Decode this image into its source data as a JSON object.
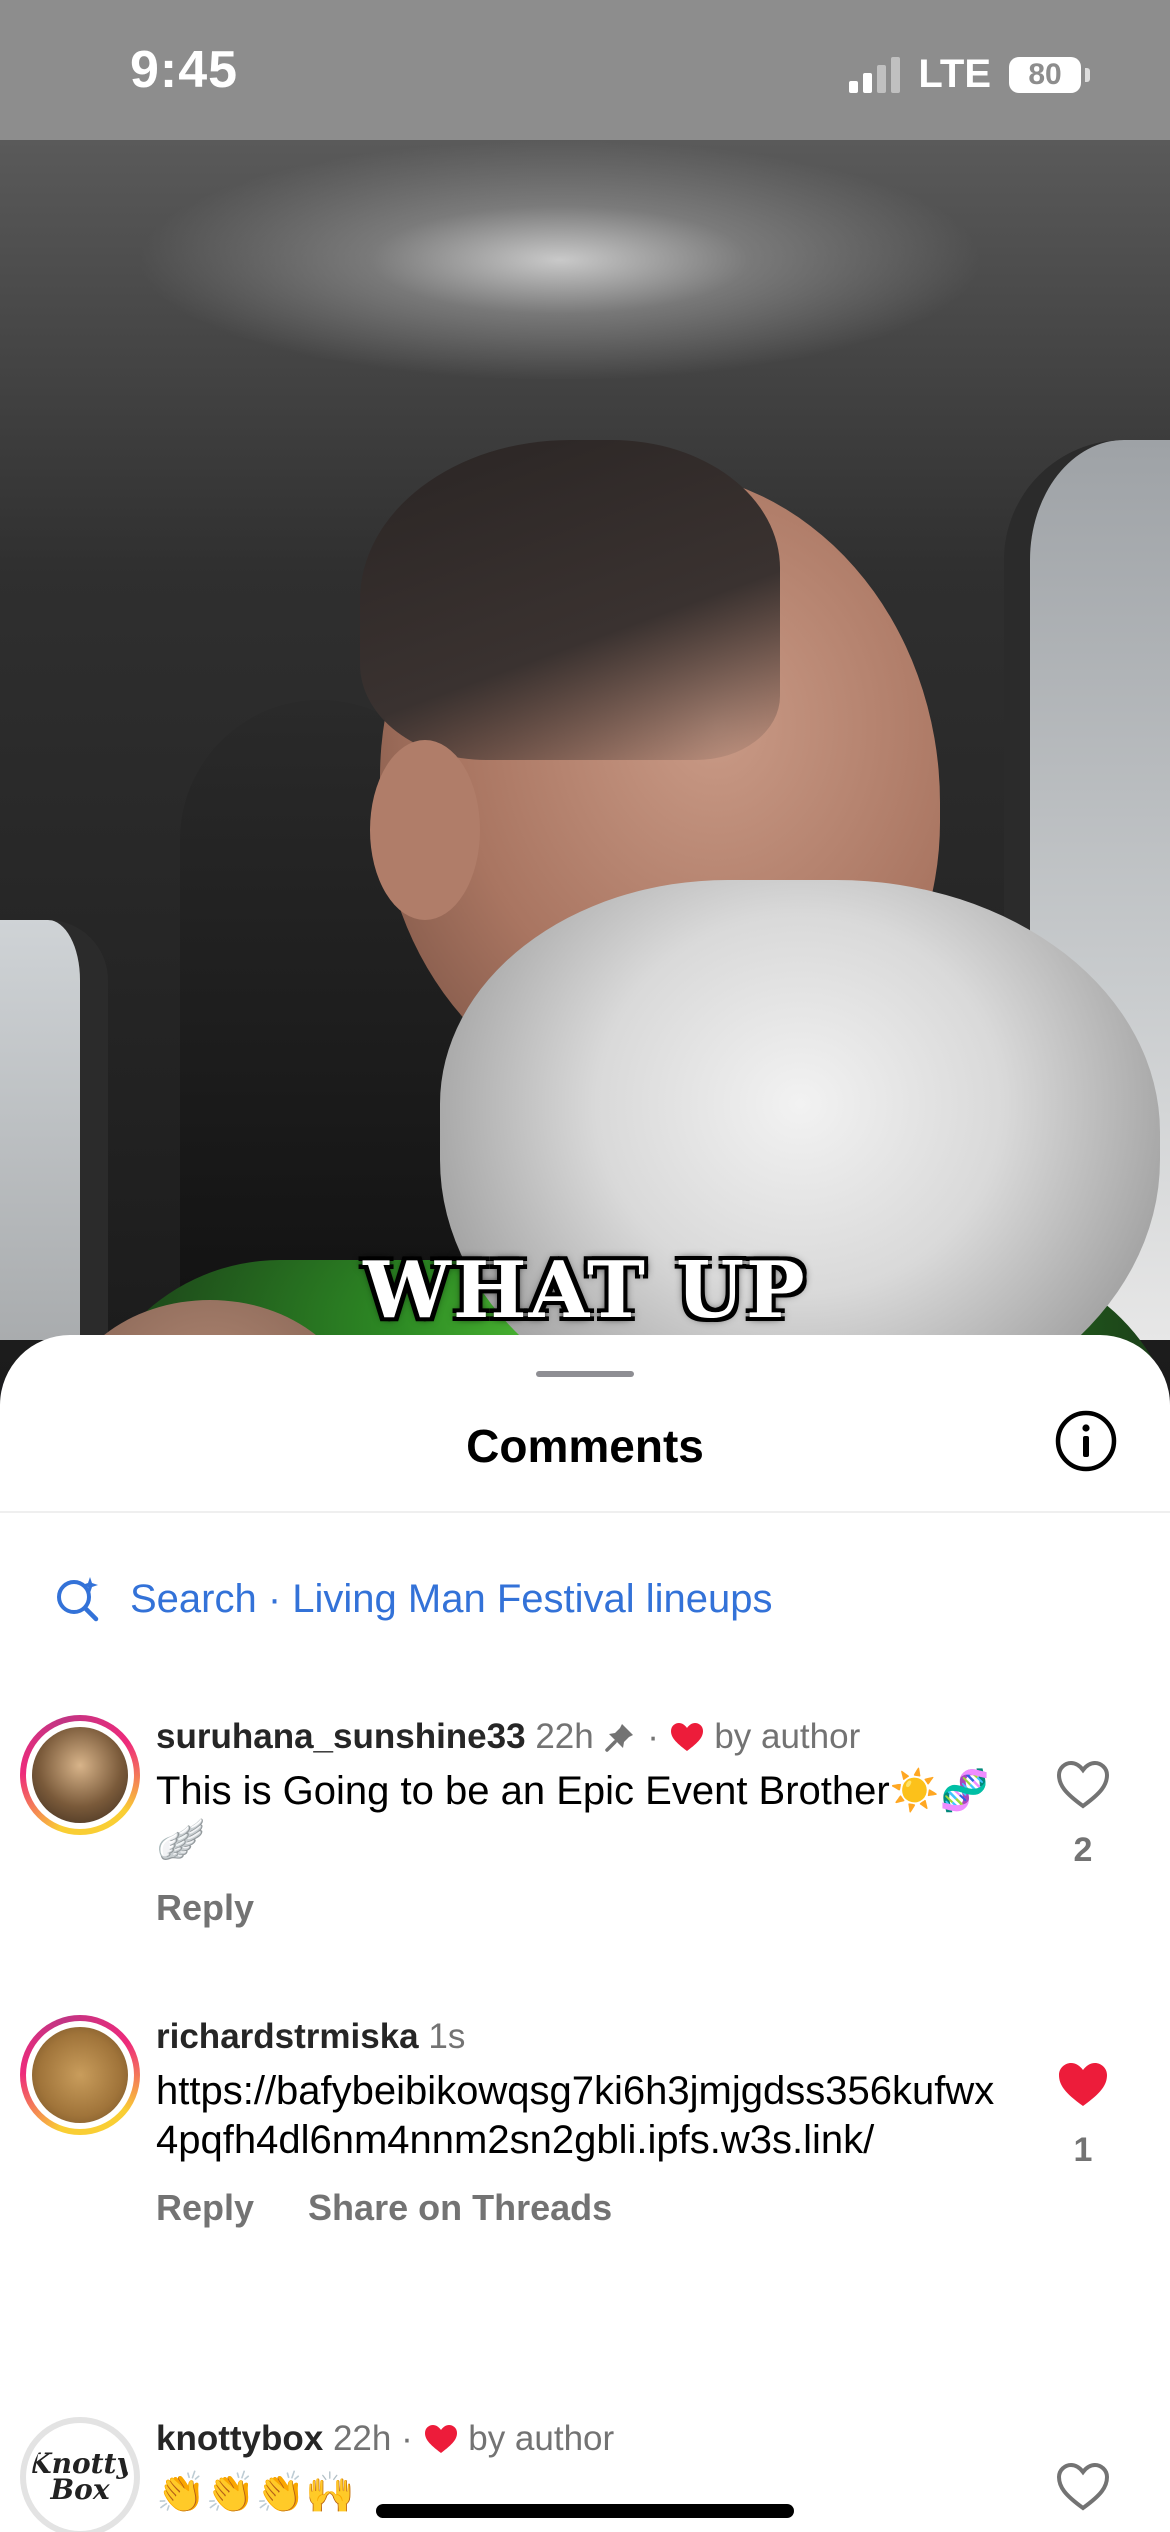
{
  "status_bar": {
    "time": "9:45",
    "network": "LTE",
    "battery": "80"
  },
  "video": {
    "caption": "WHAT UP"
  },
  "sheet": {
    "title": "Comments",
    "search_label": "Search · Living Man Festival lineups"
  },
  "comments": [
    {
      "username": "suruhana_sunshine33",
      "time": "22h",
      "pinned": true,
      "liked_by_author": "by author",
      "text": "This is Going to be an Epic Event Brother☀️🧬🪽",
      "actions": [
        "Reply"
      ],
      "like_count": "2",
      "liked": false
    },
    {
      "username": "richardstrmiska",
      "time": "1s",
      "text": "https://bafybeibikowqsg7ki6h3jmjgdss356kufwx4pqfh4dl6nm4nnm2sn2gbli.ipfs.w3s.link/",
      "actions": [
        "Reply",
        "Share on Threads"
      ],
      "like_count": "1",
      "liked": true
    },
    {
      "username": "knottybox",
      "time": "22h",
      "liked_by_author": "by author",
      "text": "👏👏👏🙌",
      "avatar_text": "Knotty Box",
      "liked": false
    }
  ],
  "colors": {
    "accent_blue": "#3372d8",
    "like_red": "#ed1c3a",
    "secondary_text": "#737373"
  }
}
